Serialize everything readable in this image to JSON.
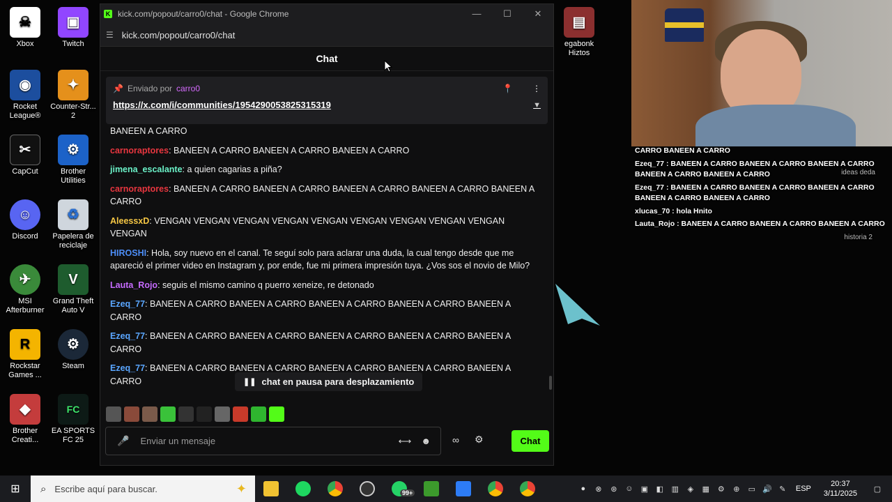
{
  "desktop": {
    "icons": [
      {
        "label": "Xbox",
        "color": "#ffffff"
      },
      {
        "label": "Twitch",
        "color": "#9146ff"
      },
      {
        "label": "Rocket League®",
        "color": "#1c4e9e"
      },
      {
        "label": "Counter-Str... 2",
        "color": "#e5901b"
      },
      {
        "label": "CapCut",
        "color": "#111111"
      },
      {
        "label": "Brother Utilities",
        "color": "#1c62c8"
      },
      {
        "label": "Discord",
        "color": "#5865f2"
      },
      {
        "label": "Papelera de reciclaje",
        "color": "#cfd6dd"
      },
      {
        "label": "MSI Afterburner",
        "color": "#3a8a3a"
      },
      {
        "label": "Grand Theft Auto V",
        "color": "#1e5c2e"
      },
      {
        "label": "Rockstar Games ...",
        "color": "#f4b400"
      },
      {
        "label": "Steam",
        "color": "#1b2838"
      },
      {
        "label": "Brother Creati...",
        "color": "#c43c3c"
      },
      {
        "label": "EA SPORTS FC 25",
        "color": "#0d1a16"
      },
      {
        "label": "egabonk Hiztos",
        "color": "#8b2f2f"
      }
    ]
  },
  "window": {
    "title": "kick.com/popout/carro0/chat - Google Chrome",
    "url": "kick.com/popout/carro0/chat",
    "minimize": "—",
    "maximize": "☐",
    "close": "✕"
  },
  "chat": {
    "header": "Chat",
    "pinned": {
      "sent_by": "Enviado por",
      "author": "carro0",
      "link": "https://x.com/i/communities/1954290053825315319"
    },
    "messages": [
      {
        "user": "",
        "color": "#ffffff",
        "text": "BANEEN A CARRO"
      },
      {
        "user": "carnoraptores",
        "color": "#e8363f",
        "text": ": BANEEN A CARRO  BANEEN A CARRO  BANEEN A CARRO"
      },
      {
        "user": "jimena_escalante",
        "color": "#6bf2c8",
        "text": ": a quien cagarias a piña?"
      },
      {
        "user": "carnoraptores",
        "color": "#e8363f",
        "text": ": BANEEN A CARRO  BANEEN A CARRO  BANEEN A CARRO  BANEEN A CARRO  BANEEN A CARRO"
      },
      {
        "user": "AleessxD",
        "color": "#f6c744",
        "text": ": VENGAN  VENGAN  VENGAN  VENGAN  VENGAN  VENGAN  VENGAN  VENGAN  VENGAN  VENGAN"
      },
      {
        "user": "HIROSHI",
        "color": "#4d8ef8",
        "text": ": Hola, soy nuevo en el canal. Te seguí solo para aclarar una duda, la cual tengo desde que me apareció el primer video en Instagram y, por ende, fue mi primera impresión tuya. ¿Vos sos el novio de Milo?"
      },
      {
        "user": "Lauta_Rojo",
        "color": "#c66bff",
        "text": ": seguis el mismo camino q puerro xeneize, re detonado"
      },
      {
        "user": "Ezeq_77",
        "color": "#5aa6ff",
        "text": ": BANEEN A CARRO  BANEEN A CARRO  BANEEN A CARRO  BANEEN A CARRO  BANEEN A CARRO"
      },
      {
        "user": "Ezeq_77",
        "color": "#5aa6ff",
        "text": ": BANEEN A CARRO  BANEEN A CARRO  BANEEN A CARRO  BANEEN A CARRO  BANEEN A CARRO"
      },
      {
        "user": "Ezeq_77",
        "color": "#5aa6ff",
        "text": ": BANEEN A CARRO  BANEEN A CARRO  BANEEN A CARRO  BANEEN A CARRO  BANEEN A CARRO"
      }
    ],
    "pause_notice": "chat en pausa para desplazamiento",
    "input_placeholder": "Enviar un mensaje",
    "send_label": "Chat"
  },
  "overlay": {
    "lines": [
      "CARRO  BANEEN A CARRO",
      "Ezeq_77 : BANEEN A CARRO  BANEEN A CARRO  BANEEN A CARRO  BANEEN A CARRO  BANEEN A CARRO",
      "Ezeq_77 : BANEEN A CARRO  BANEEN A CARRO  BANEEN A CARRO  BANEEN A CARRO  BANEEN A CARRO",
      "xlucas_70 : hola Hnito",
      "Lauta_Rojo : BANEEN A CARRO  BANEEN A CARRO  BANEEN A CARRO"
    ],
    "side_labels": [
      "ideas deda",
      "historia 2"
    ]
  },
  "taskbar": {
    "search_placeholder": "Escribe aquí para buscar.",
    "badge": "99+",
    "language": "ESP",
    "time": "20:37",
    "date": "3/11/2025"
  }
}
